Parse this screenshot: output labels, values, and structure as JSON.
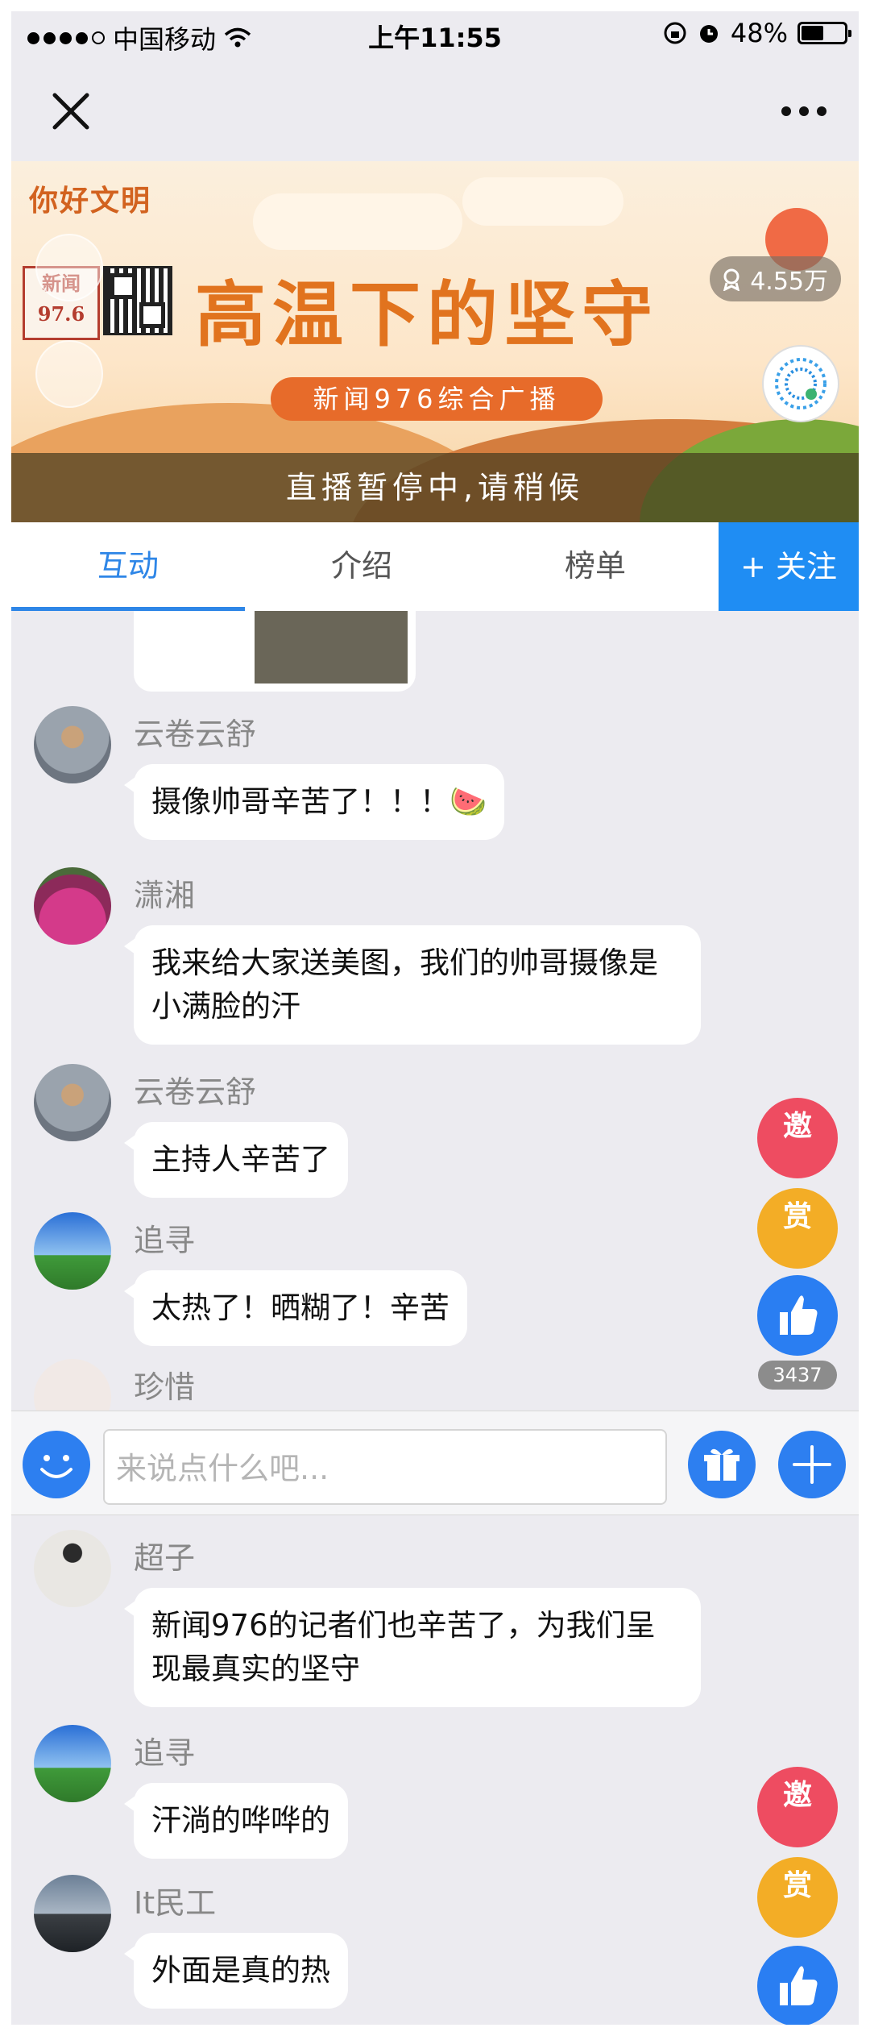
{
  "status_bar": {
    "carrier": "中国移动",
    "time": "上午11:55",
    "battery": "48%",
    "battery_level": 0.48
  },
  "banner": {
    "brand_text": "你好文明",
    "logo_text": "新闻 97.6",
    "headline": "高温下的坚守",
    "station": "新闻976综合广播",
    "viewer_count": "4.55万",
    "paused_text": "直播暂停中,请稍候"
  },
  "tabs": [
    {
      "label": "互动",
      "active": true
    },
    {
      "label": "介绍",
      "active": false
    },
    {
      "label": "榜单",
      "active": false
    }
  ],
  "follow_label": "+ 关注",
  "messages_top": [
    {
      "user": "云卷云舒",
      "text": "摄像帅哥辛苦了！！！🍉",
      "avatar": "stones"
    },
    {
      "user": "潇湘",
      "text": "我来给大家送美图，我们的帅哥摄像是小满脸的汗",
      "avatar": "flowers"
    },
    {
      "user": "云卷云舒",
      "text": "主持人辛苦了",
      "avatar": "stones"
    },
    {
      "user": "追寻",
      "text": "太热了！晒糊了！辛苦",
      "avatar": "sky"
    },
    {
      "user": "珍惜",
      "text": "",
      "avatar": "pale"
    }
  ],
  "messages_bottom": [
    {
      "user": "超子",
      "text": "新闻976的记者们也辛苦了，为我们呈现最真实的坚守",
      "avatar": "person"
    },
    {
      "user": "追寻",
      "text": "汗淌的哗哗的",
      "avatar": "sky"
    },
    {
      "user": "It民工",
      "text": "外面是真的热",
      "avatar": "dusk"
    }
  ],
  "fab": {
    "invite": "邀",
    "reward": "赏",
    "like_count": "3437"
  },
  "input": {
    "placeholder": "来说点什么吧..."
  },
  "colors": {
    "accent": "#2e86e7",
    "follow": "#1f8df3",
    "invite": "#ee4c61",
    "reward": "#f3ad26",
    "like": "#2a7ef2"
  }
}
